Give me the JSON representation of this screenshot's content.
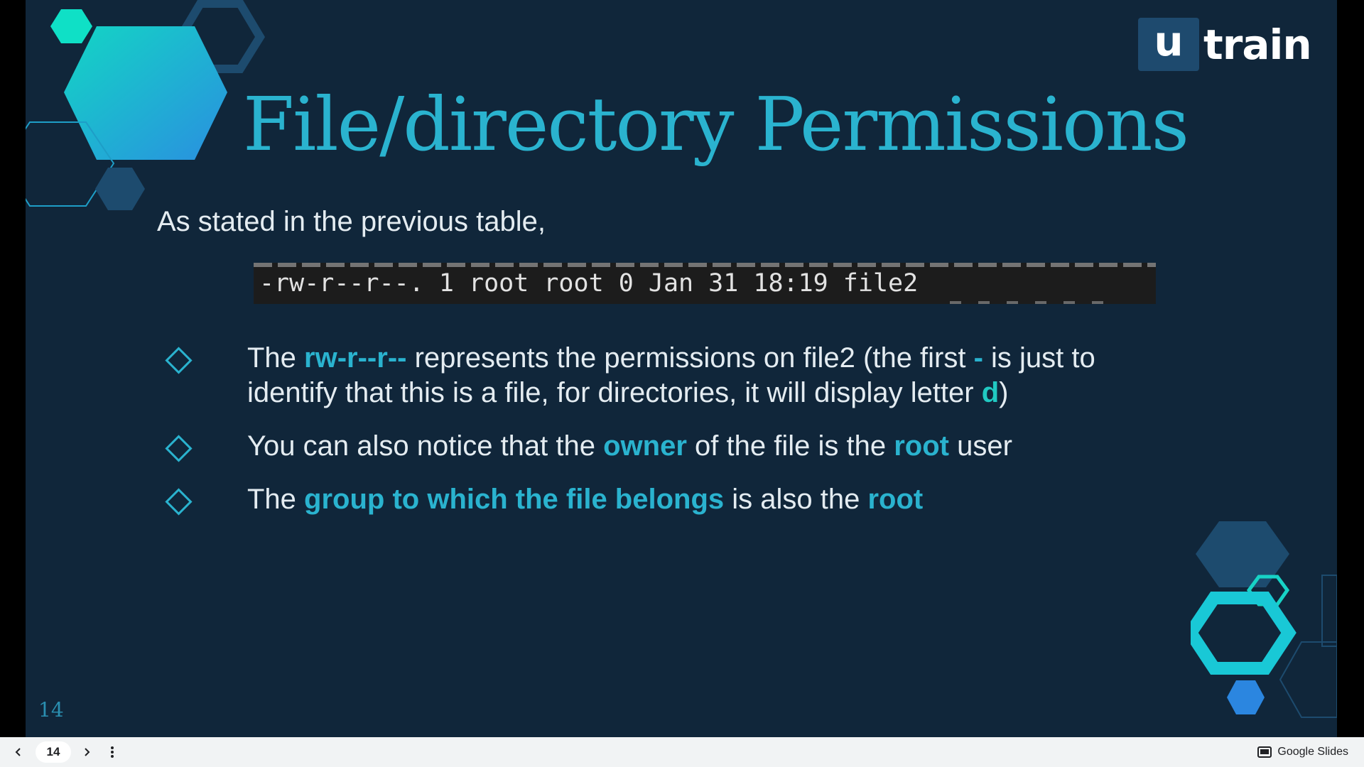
{
  "logo": {
    "mark": "u",
    "text": "train"
  },
  "title": "File/directory Permissions",
  "intro": "As stated in the previous table,",
  "terminal_line": "-rw-r--r--. 1 root root 0 Jan 31 18:19 file2",
  "bullets": [
    {
      "p1": "The ",
      "h1": "rw-r--r--",
      "p2": " represents the permissions on file2 (the first ",
      "h2": "-",
      "p3": " is just to identify that this is a file, for directories, it will display letter ",
      "h3": "d",
      "p4": ")"
    },
    {
      "p1": "You can also notice that the ",
      "h1": "owner",
      "p2": " of the file is the ",
      "h2": "root",
      "p3": " user"
    },
    {
      "p1": "The ",
      "h1": "group to which the file belongs",
      "p2": " is also the ",
      "h2": "root"
    }
  ],
  "slide_number": "14",
  "toolbar": {
    "prev_icon": "chevron-left-icon",
    "page_value": "14",
    "next_icon": "chevron-right-icon",
    "menu_icon": "more-vertical-icon",
    "brand_icon": "slides-icon",
    "brand_label": "Google Slides"
  },
  "colors": {
    "background": "#10263a",
    "accent": "#2ab3cf",
    "teal": "#21c9c2",
    "text": "#e4ecf1"
  }
}
